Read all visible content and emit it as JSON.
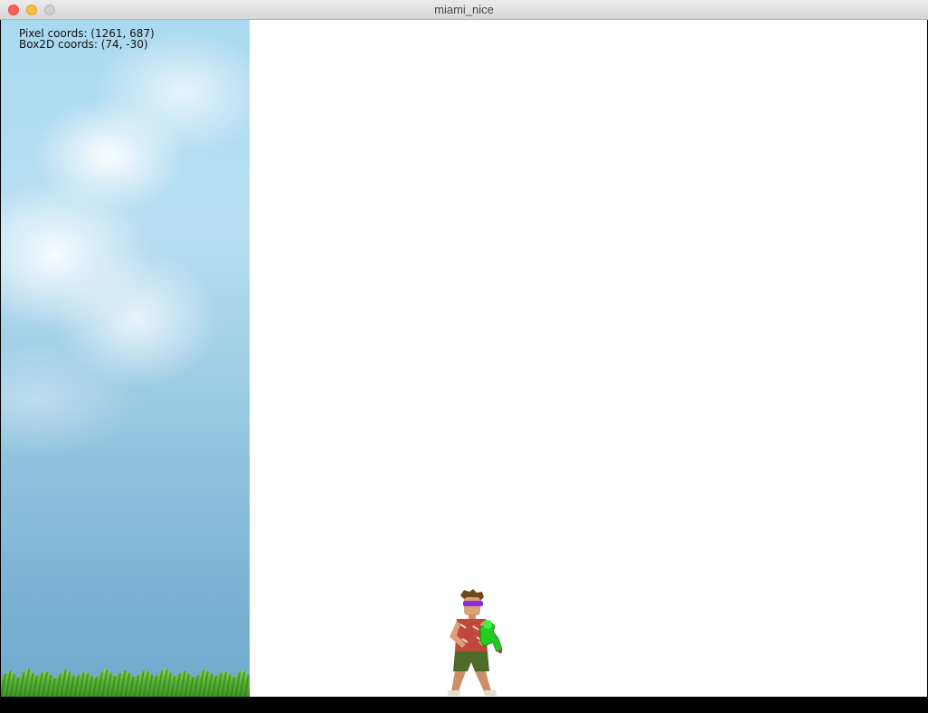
{
  "window": {
    "title": "miami_nice",
    "controls": {
      "close": "close-button",
      "minimize": "minimize-button",
      "zoom": "zoom-button"
    }
  },
  "hud": {
    "pixel_coords": "Pixel coords: (1261, 687)",
    "box2d_coords": "Box2D coords: (74, -30)"
  },
  "scene": {
    "background_left": "sky-with-clouds",
    "ground_strip": "grass",
    "player_sprite": "character-with-water-gun",
    "colors": {
      "sky_top": "#a9d9f0",
      "sky_bottom": "#6fa9cc",
      "grass": "#5db33a",
      "canvas_bg": "#ffffff",
      "sunglasses": "#8a2be2",
      "water_gun": "#22cc22"
    }
  }
}
